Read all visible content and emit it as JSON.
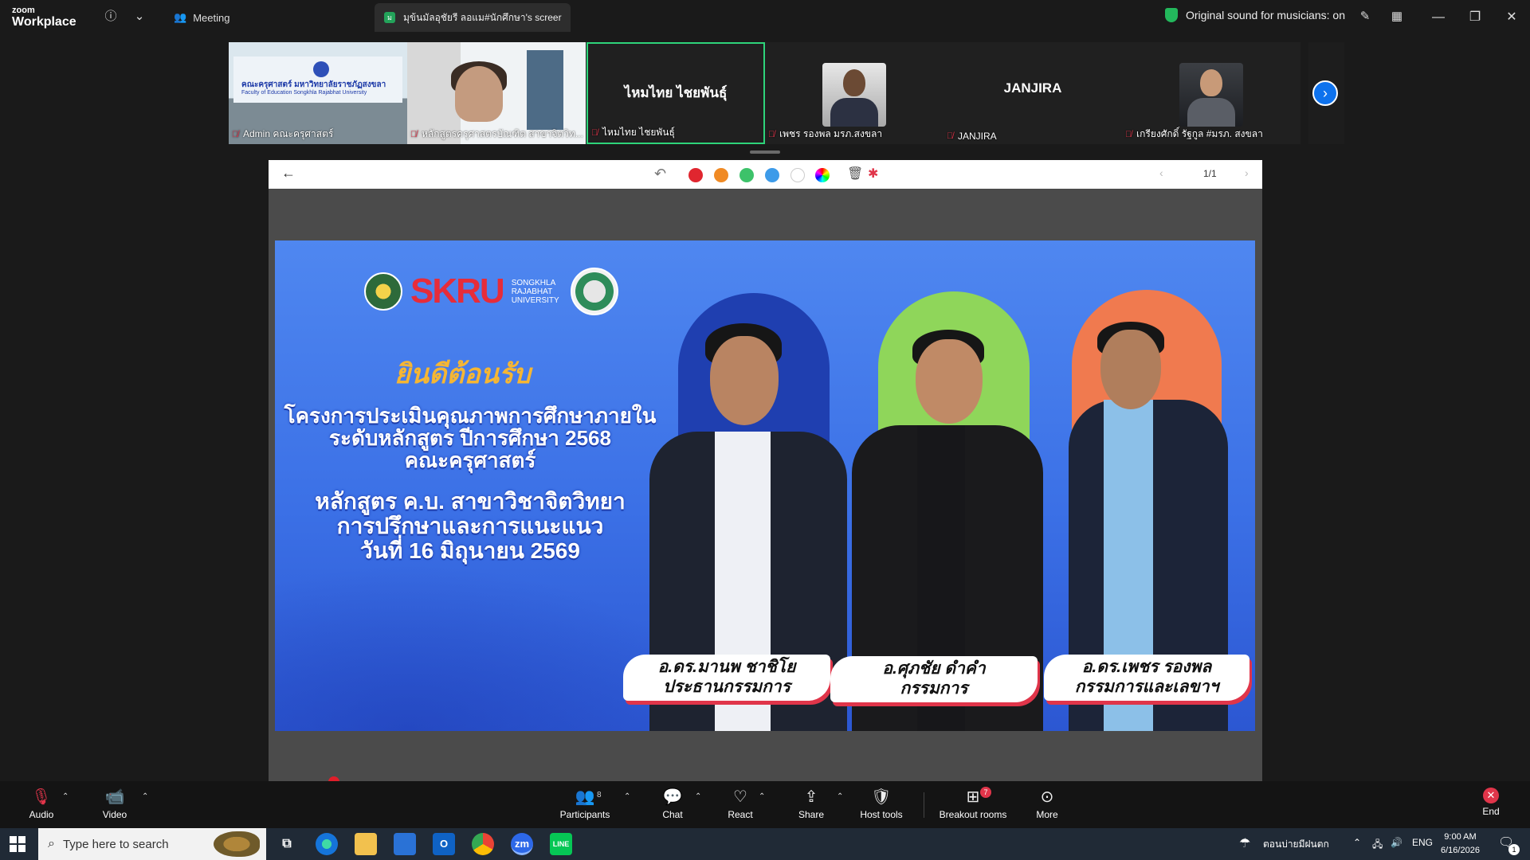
{
  "titlebar": {
    "logo_top": "zoom",
    "logo_bottom": "Workplace",
    "meeting_label": "Meeting",
    "share_tab_label": "มุข้นมัลอุชัยรี ลอแม#นักศึกษา's screer",
    "share_tab_badge": "ม",
    "sound_label": "Original sound for musicians: on"
  },
  "gallery": {
    "tiles": [
      {
        "name": "Admin คณะครุศาสตร์",
        "banner_line1": "คณะครุศาสตร์ มหาวิทยาลัยราชภัฏสงขลา",
        "banner_line2": "Faculty of Education Songkhla Rajabhat University"
      },
      {
        "name": "หลักสูตรครุศาสตรบัณฑิต สาขาจิตวิท..."
      },
      {
        "name": "ไหมไทย ไชยพันธุ์",
        "center": "ไหมไทย ไชยพันธุ์"
      },
      {
        "name": "เพชร รองพล มรภ.สงขลา"
      },
      {
        "name": "JANJIRA",
        "center": "JANJIRA"
      },
      {
        "name": "เกรียงศักดิ์ รัฐกูล #มรภ. สงขลา"
      }
    ]
  },
  "annotation": {
    "colors": [
      "#e0262f",
      "#f08a24",
      "#3dc26a",
      "#3d9be9",
      "#ffffff"
    ],
    "page": "1/1"
  },
  "slide": {
    "logo_text": "SKRU",
    "logo_sub": "SONGKHLA RAJABHAT UNIVERSITY",
    "welcome": "ยินดีต้อนรับ",
    "line1": "โครงการประเมินคุณภาพการศึกษาภายใน",
    "line2": "ระดับหลักสูตร ปีการศึกษา 2568",
    "line3": "คณะครุศาสตร์",
    "line4": "หลักสูตร ค.บ. สาขาวิชาจิตวิทยา",
    "line5": "การปรึกษาและการแนะแนว",
    "line6": "วันที่ 16 มิถุนายน 2569",
    "people": [
      {
        "name": "อ.ดร.มานพ ชาชิโย",
        "role": "ประธานกรรมการ",
        "arch_color": "#1f3fb0"
      },
      {
        "name": "อ.ศุภชัย ดำคำ",
        "role": "กรรมการ",
        "arch_color": "#8fd65a"
      },
      {
        "name": "อ.ดร.เพชร รองพล",
        "role": "กรรมการและเลขาฯ",
        "arch_color": "#f07a4f"
      }
    ]
  },
  "controls": {
    "audio": "Audio",
    "video": "Video",
    "participants": "Participants",
    "participants_count": "8",
    "chat": "Chat",
    "react": "React",
    "share": "Share",
    "host_tools": "Host tools",
    "breakout": "Breakout rooms",
    "breakout_badge": "7",
    "more": "More",
    "end": "End"
  },
  "taskbar": {
    "search_placeholder": "Type here to search",
    "weather": "ตอนบ่ายมีฝนตก",
    "lang": "ENG",
    "time": "9:00 AM",
    "date": "6/16/2026",
    "notif_count": "1"
  }
}
